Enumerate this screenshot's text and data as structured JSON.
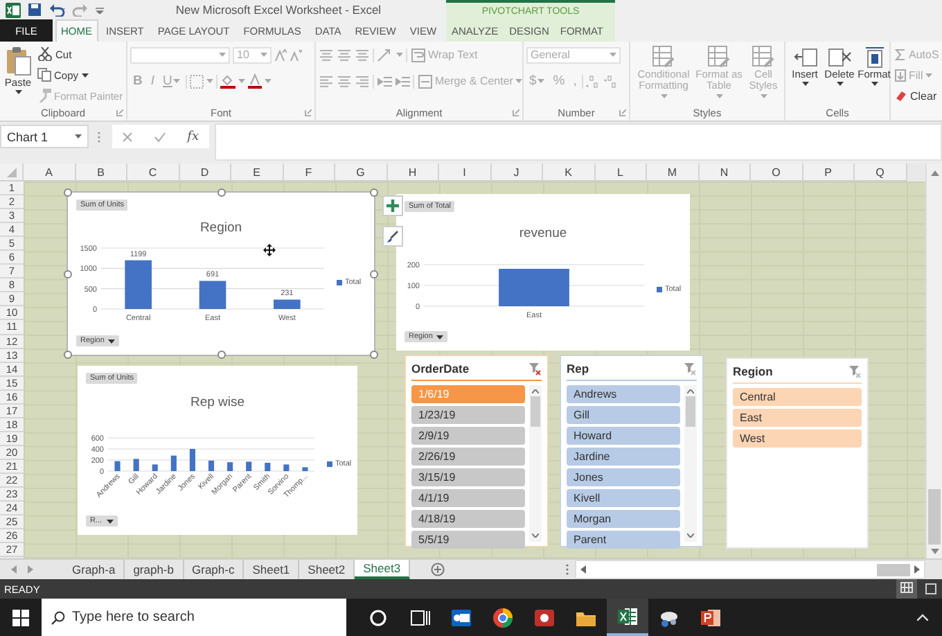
{
  "window": {
    "title": "New Microsoft Excel Worksheet - Excel",
    "contextual_label": "PIVOTCHART TOOLS"
  },
  "tabs": [
    {
      "label": "FILE",
      "kind": "file",
      "selected": false
    },
    {
      "label": "HOME",
      "kind": "standard",
      "selected": true
    },
    {
      "label": "INSERT",
      "kind": "standard",
      "selected": false
    },
    {
      "label": "PAGE LAYOUT",
      "kind": "standard",
      "selected": false
    },
    {
      "label": "FORMULAS",
      "kind": "standard",
      "selected": false
    },
    {
      "label": "DATA",
      "kind": "standard",
      "selected": false
    },
    {
      "label": "REVIEW",
      "kind": "standard",
      "selected": false
    },
    {
      "label": "VIEW",
      "kind": "standard",
      "selected": false
    },
    {
      "label": "ANALYZE",
      "kind": "contextual",
      "selected": false
    },
    {
      "label": "DESIGN",
      "kind": "contextual",
      "selected": false
    },
    {
      "label": "FORMAT",
      "kind": "contextual",
      "selected": false
    }
  ],
  "ribbon": {
    "groups": [
      {
        "kind": "clipboard",
        "label": "Clipboard",
        "items": [
          {
            "label": "Paste",
            "disabled": false
          },
          {
            "label": "Cut",
            "disabled": false
          },
          {
            "label": "Copy",
            "disabled": false
          },
          {
            "label": "Format Painter",
            "disabled": true
          }
        ]
      },
      {
        "kind": "font",
        "label": "Font",
        "disabled": true,
        "font_size": "10",
        "styles": [
          "B",
          "I",
          "U"
        ]
      },
      {
        "kind": "alignment",
        "label": "Alignment",
        "disabled": true,
        "items": [
          "Wrap Text",
          "Merge & Center"
        ]
      },
      {
        "kind": "number",
        "label": "Number",
        "disabled": true,
        "format": "General",
        "symbols": [
          "$",
          "%",
          ","
        ]
      },
      {
        "kind": "styles",
        "label": "Styles",
        "disabled": true,
        "items": [
          "Conditional Formatting",
          "Format as Table",
          "Cell Styles"
        ]
      },
      {
        "kind": "cells",
        "label": "Cells",
        "disabled": false,
        "items": [
          "Insert",
          "Delete",
          "Format"
        ]
      },
      {
        "kind": "editing",
        "items": [
          {
            "label": "AutoS",
            "disabled": true
          },
          {
            "label": "Fill",
            "disabled": true
          },
          {
            "label": "Clear",
            "disabled": false
          }
        ]
      }
    ]
  },
  "formula_bar": {
    "name_box": "Chart 1",
    "function_label": "fx"
  },
  "sheet": {
    "columns": [
      "A",
      "B",
      "C",
      "D",
      "E",
      "F",
      "G",
      "H",
      "I",
      "J",
      "K",
      "L",
      "M",
      "N",
      "O",
      "P",
      "Q"
    ],
    "rows": [
      "1",
      "2",
      "3",
      "4",
      "5",
      "6",
      "7",
      "8",
      "9",
      "10",
      "11",
      "12",
      "13",
      "14",
      "15",
      "16",
      "17",
      "18",
      "19",
      "20",
      "21",
      "22",
      "23",
      "24",
      "25",
      "26",
      "27"
    ],
    "charts": [
      {
        "selected": true,
        "value_field": "Sum of Units",
        "axis_field": "Region",
        "chart_data": {
          "type": "bar",
          "title": "Region",
          "categories": [
            "Central",
            "East",
            "West"
          ],
          "series": [
            {
              "name": "Total",
              "color": "#4472c4",
              "values": [
                1199,
                691,
                231
              ]
            }
          ],
          "ylim": [
            0,
            1500
          ],
          "yticks": [
            0,
            500,
            1000,
            1500
          ],
          "data_labels": true
        }
      },
      {
        "selected": false,
        "value_field": "Sum of Total",
        "axis_field": "Region",
        "chart_data": {
          "type": "bar",
          "title": "revenue",
          "categories": [
            "East"
          ],
          "series": [
            {
              "name": "Total",
              "color": "#4472c4",
              "values": [
                180
              ]
            }
          ],
          "ylim": [
            0,
            200
          ],
          "yticks": [
            0,
            100,
            200
          ]
        }
      },
      {
        "selected": false,
        "value_field": "Sum of Units",
        "axis_field": "R...",
        "chart_data": {
          "type": "bar",
          "title": "Rep wise",
          "categories": [
            "Andrews",
            "Gill",
            "Howard",
            "Jardine",
            "Jones",
            "Kivell",
            "Morgan",
            "Parent",
            "Smith",
            "Sorvino",
            "Thomp..."
          ],
          "series": [
            {
              "name": "Total",
              "color": "#4472c4",
              "values": [
                180,
                220,
                120,
                280,
                400,
                190,
                160,
                170,
                150,
                120,
                70
              ]
            }
          ],
          "ylim": [
            0,
            600
          ],
          "yticks": [
            0,
            200,
            400,
            600
          ]
        }
      }
    ],
    "slicers": [
      {
        "title": "OrderDate",
        "color": "#f79646",
        "filtered": true,
        "items": [
          {
            "label": "1/6/19",
            "selected": true
          },
          {
            "label": "1/23/19",
            "selected": false
          },
          {
            "label": "2/9/19",
            "selected": false
          },
          {
            "label": "2/26/19",
            "selected": false
          },
          {
            "label": "3/15/19",
            "selected": false
          },
          {
            "label": "4/1/19",
            "selected": false
          },
          {
            "label": "4/18/19",
            "selected": false
          },
          {
            "label": "5/5/19",
            "selected": false
          }
        ]
      },
      {
        "title": "Rep",
        "color": "#b7cbe6",
        "filtered": false,
        "items": [
          {
            "label": "Andrews",
            "selected": true
          },
          {
            "label": "Gill",
            "selected": true
          },
          {
            "label": "Howard",
            "selected": true
          },
          {
            "label": "Jardine",
            "selected": true
          },
          {
            "label": "Jones",
            "selected": true
          },
          {
            "label": "Kivell",
            "selected": true
          },
          {
            "label": "Morgan",
            "selected": true
          },
          {
            "label": "Parent",
            "selected": true
          }
        ]
      },
      {
        "title": "Region",
        "color": "#fcd5b4",
        "filtered": false,
        "items": [
          {
            "label": "Central",
            "selected": true
          },
          {
            "label": "East",
            "selected": true
          },
          {
            "label": "West",
            "selected": true
          }
        ]
      }
    ]
  },
  "sheet_tabs": [
    {
      "label": "Graph-a",
      "selected": false
    },
    {
      "label": "graph-b",
      "selected": false
    },
    {
      "label": "Graph-c",
      "selected": false
    },
    {
      "label": "Sheet1",
      "selected": false
    },
    {
      "label": "Sheet2",
      "selected": false
    },
    {
      "label": "Sheet3",
      "selected": true
    }
  ],
  "status_bar": {
    "text": "READY"
  },
  "taskbar": {
    "search_placeholder": "Type here to search",
    "apps": [
      {
        "kind": "cortana",
        "selected": false
      },
      {
        "kind": "task_view",
        "selected": false
      },
      {
        "kind": "mail",
        "selected": false
      },
      {
        "kind": "browser",
        "selected": false
      },
      {
        "kind": "recorder",
        "selected": false
      },
      {
        "kind": "folder",
        "selected": false
      },
      {
        "kind": "spreadsheet",
        "selected": true
      },
      {
        "kind": "network",
        "selected": false
      },
      {
        "kind": "presentation",
        "selected": false
      }
    ]
  }
}
